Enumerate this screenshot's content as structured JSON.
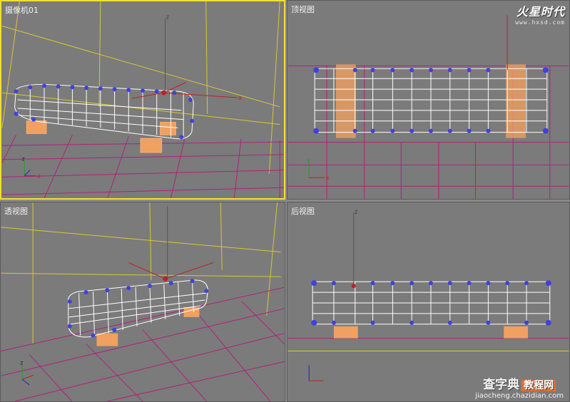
{
  "viewports": {
    "camera": {
      "label": "摄像机01"
    },
    "top": {
      "label": "顶视图"
    },
    "perspective": {
      "label": "透视图"
    },
    "back": {
      "label": "后视图"
    }
  },
  "logo": {
    "text": "火星时代",
    "url": "www.hxsd.com"
  },
  "watermark": {
    "text": "查字典",
    "tag": "教程网",
    "url": "jiaocheng.chazidian.com"
  },
  "axes": {
    "z": "z",
    "x": "x",
    "y": "y"
  },
  "colors": {
    "viewport_bg": "#7b7b7b",
    "grid_magenta": "#b0207a",
    "frame_yellow": "#e8d830",
    "mesh_white": "#ffffff",
    "vertex_blue": "#4040e0",
    "leg_orange": "#f0a060",
    "gizmo_red": "#c02020",
    "active_border": "#f0e030"
  }
}
